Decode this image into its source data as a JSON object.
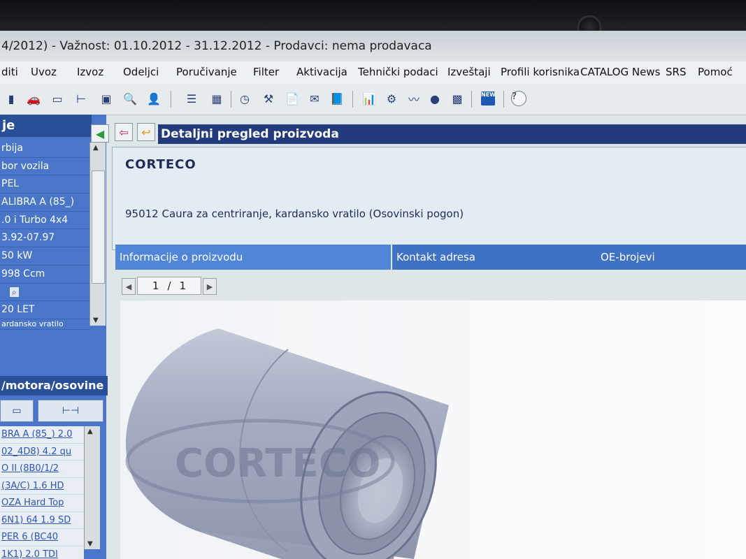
{
  "window": {
    "title": "4/2012)  -  Važnost: 01.10.2012 - 31.12.2012  -  Prodavci: nema prodavaca"
  },
  "menu": [
    {
      "id": "uredi",
      "label": "diti"
    },
    {
      "id": "uvoz",
      "label": "Uvoz"
    },
    {
      "id": "izvoz",
      "label": "Izvoz"
    },
    {
      "id": "odeljci",
      "label": "Odeljci"
    },
    {
      "id": "porucivanje",
      "label": "Poručivanje"
    },
    {
      "id": "filter",
      "label": "Filter"
    },
    {
      "id": "aktivacija",
      "label": "Aktivacija"
    },
    {
      "id": "tehnicki",
      "label": "Tehnički podaci"
    },
    {
      "id": "izvestaji",
      "label": "Izveštaji"
    },
    {
      "id": "profili",
      "label": "Profili korisnika"
    },
    {
      "id": "catalog",
      "label": "CATALOG News"
    },
    {
      "id": "srs",
      "label": "SRS"
    },
    {
      "id": "pomoc",
      "label": "Pomoć"
    }
  ],
  "sidebar": {
    "header": "je",
    "items": [
      "rbija",
      "bor vozila",
      "PEL",
      "ALIBRA A (85_)",
      ".0 i Turbo 4x4",
      "3.92-07.97",
      "50 kW",
      "998 Ccm",
      "",
      " 20 LET",
      "ardansko vratilo"
    ],
    "section_title": "/motora/osovine",
    "vehicle_list": [
      "BRA A (85_) 2.0",
      "02_4D8) 4.2 qu",
      "O II (8B0/1/2",
      "(3A/C) 1.6 HD",
      "OZA Hard Top",
      "6N1) 64 1.9 SD",
      "PER 6 (BC40",
      "1K1) 2.0 TDI"
    ]
  },
  "main": {
    "header": "Detaljni pregled proizvoda",
    "brand": "CORTECO",
    "product_line": "95012 Caura za centriranje, kardansko vratilo (Osovinski pogon)",
    "tabs": [
      {
        "label": "Informacije o proizvodu",
        "active": true
      },
      {
        "label": "Kontakt adresa",
        "active": false
      },
      {
        "label": "OE-brojevi",
        "active": false
      }
    ],
    "pager": {
      "current": "1",
      "separator": "/",
      "total": "1"
    },
    "image_watermark": "CORTECO"
  },
  "colors": {
    "header_dark": "#233a7c",
    "tab_blue": "#3f72c4",
    "sidebar_blue": "#4a76c9"
  }
}
